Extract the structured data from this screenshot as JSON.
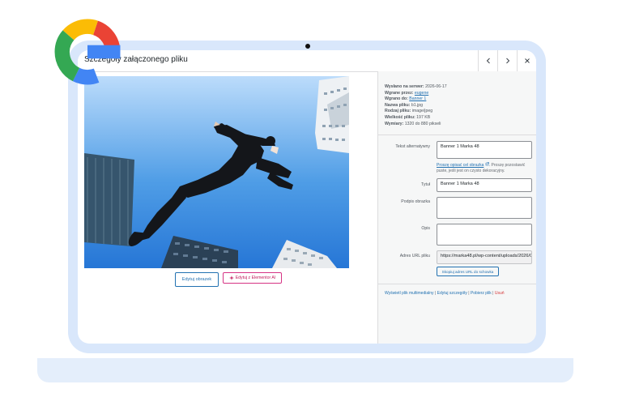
{
  "modal": {
    "title": "Szczegóły załączonego pliku",
    "prev_glyph": "‹",
    "next_glyph": "›",
    "close_glyph": "×"
  },
  "preview": {
    "edit_image_label": "Edytuj obrazek",
    "edit_elementor_label": "Edytuj z Elementor AI"
  },
  "details": {
    "uploaded_on_label": "Wysłano na serwer:",
    "uploaded_on_value": "2026-06-17",
    "uploaded_by_label": "Wgrane przez:",
    "uploaded_by_value": "eugene",
    "uploaded_to_label": "Wgrano do:",
    "uploaded_to_value": "Banner 1",
    "file_name_label": "Nazwa pliku:",
    "file_name_value": "b1.jpg",
    "file_type_label": "Rodzaj pliku:",
    "file_type_value": "image/jpeg",
    "file_size_label": "Wielkość pliku:",
    "file_size_value": "197 KB",
    "dimensions_label": "Wymiary:",
    "dimensions_value": "1320 do 880 pikseli"
  },
  "form": {
    "alt_label": "Tekst alternatywny",
    "alt_value": "Banner 1 Marka 48",
    "alt_help_link": "Proszę opisać cel obrazka",
    "alt_help_text": ". Proszę pozostawić puste, jeśli jest on czysto dekoracyjny.",
    "title_label": "Tytuł",
    "title_value": "Banner 1 Marka 48",
    "caption_label": "Podpis obrazka",
    "caption_value": "",
    "description_label": "Opis",
    "description_value": "",
    "url_label": "Adres URL pliku",
    "url_value": "https://marka48.pl/wp-content/uploads/2026/06/b1.jpg",
    "copy_label": "Skopiuj adres URL do schowka"
  },
  "actions": {
    "view": "Wyświetl plik multimedialny",
    "sep": " | ",
    "edit": "Edytuj szczegóły",
    "download": "Pobierz plik",
    "delete": "Usuń"
  },
  "colors": {
    "accent": "#2271b1",
    "elementor": "#d63384",
    "danger": "#d63638",
    "device": "#d9e7fb"
  },
  "icons": {
    "brand_logo": "google-g-logo",
    "external": "external-link-icon",
    "sparkle": "sparkle-icon"
  }
}
